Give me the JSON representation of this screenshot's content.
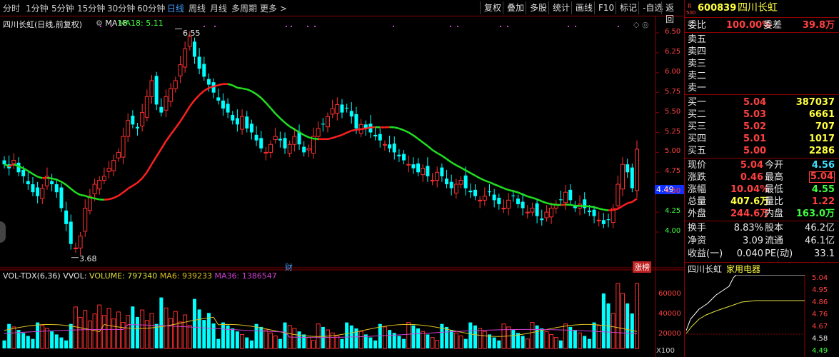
{
  "toolbar": {
    "periods": [
      "分时",
      "1分钟",
      "5分钟",
      "15分钟",
      "30分钟",
      "60分钟",
      "日线",
      "周线",
      "月线",
      "多周期",
      "更多 >"
    ],
    "active_period": "日线",
    "right_buttons": [
      "复权",
      "叠加",
      "多股",
      "统计",
      "画线",
      "F10",
      "标记",
      "-自选",
      "返回"
    ]
  },
  "chart": {
    "title": "四川长虹(日线,前复权)",
    "ma_label": "MA18",
    "ma_value": "MA18: 5.11",
    "high_mark": "6.55",
    "low_mark": "3.68",
    "price_ticks": [
      "6.50",
      "6.25",
      "6.00",
      "5.75",
      "5.50",
      "5.25",
      "5.00",
      "4.75",
      "4.50",
      "4.25",
      "4.00"
    ],
    "current_price_tag": "4.49",
    "event_caicheng": "财",
    "event_zhangbang": "涨榜",
    "vol_title": "VOL-TDX(6,36)",
    "vol_vvol": "VVOL:",
    "vol_volume": "VOLUME: 797340",
    "vol_ma6": "MA6: 939233",
    "vol_ma36": "MA36: 1386547",
    "vol_ticks": [
      "60000",
      "40000",
      "20000"
    ],
    "vol_unit": "X100",
    "colors": {
      "up": "#ff3030",
      "down": "#00ffff",
      "ma18_up": "#ff2020",
      "ma18_down": "#20e020",
      "ma6": "#e0c020",
      "ma36": "#d040d0"
    }
  },
  "quote": {
    "code": "600839",
    "name": "四川长虹",
    "r_badge": "R",
    "num_badge": "500",
    "weibi_label": "委比",
    "weibi_value": "100.00%",
    "weicha_label": "委差",
    "weicha_value": "39.8万",
    "sells": [
      "卖五",
      "卖四",
      "卖三",
      "卖二",
      "卖一"
    ],
    "buys": [
      {
        "label": "买一",
        "price": "5.04",
        "vol": "387037"
      },
      {
        "label": "买二",
        "price": "5.03",
        "vol": "6661"
      },
      {
        "label": "买三",
        "price": "5.02",
        "vol": "707"
      },
      {
        "label": "买四",
        "price": "5.01",
        "vol": "1017"
      },
      {
        "label": "买五",
        "price": "5.00",
        "vol": "2286"
      }
    ],
    "stats": [
      {
        "l1": "现价",
        "v1": "5.04",
        "l2": "今开",
        "v2": "4.56"
      },
      {
        "l1": "涨跌",
        "v1": "0.46",
        "l2": "最高",
        "v2": "5.04"
      },
      {
        "l1": "涨幅",
        "v1": "10.04%",
        "l2": "最低",
        "v2": "4.55"
      },
      {
        "l1": "总量",
        "v1": "407.6万",
        "l2": "量比",
        "v2": "1.22"
      },
      {
        "l1": "外盘",
        "v1": "244.6万",
        "l2": "内盘",
        "v2": "163.0万"
      }
    ],
    "stats2": [
      {
        "l1": "换手",
        "v1": "8.83%",
        "l2": "股本",
        "v2": "46.2亿"
      },
      {
        "l1": "净资",
        "v1": "3.09",
        "l2": "流通",
        "v2": "46.1亿"
      },
      {
        "l1": "收益(一)",
        "v1": "0.040",
        "l2": "PE(动)",
        "v2": "33.1"
      }
    ],
    "mini_name": "四川长虹",
    "mini_sector": "家用电器",
    "mini_ticks": [
      "5.04",
      "4.95",
      "4.86",
      "4.76",
      "4.67",
      "4.58",
      "4.49"
    ]
  }
}
